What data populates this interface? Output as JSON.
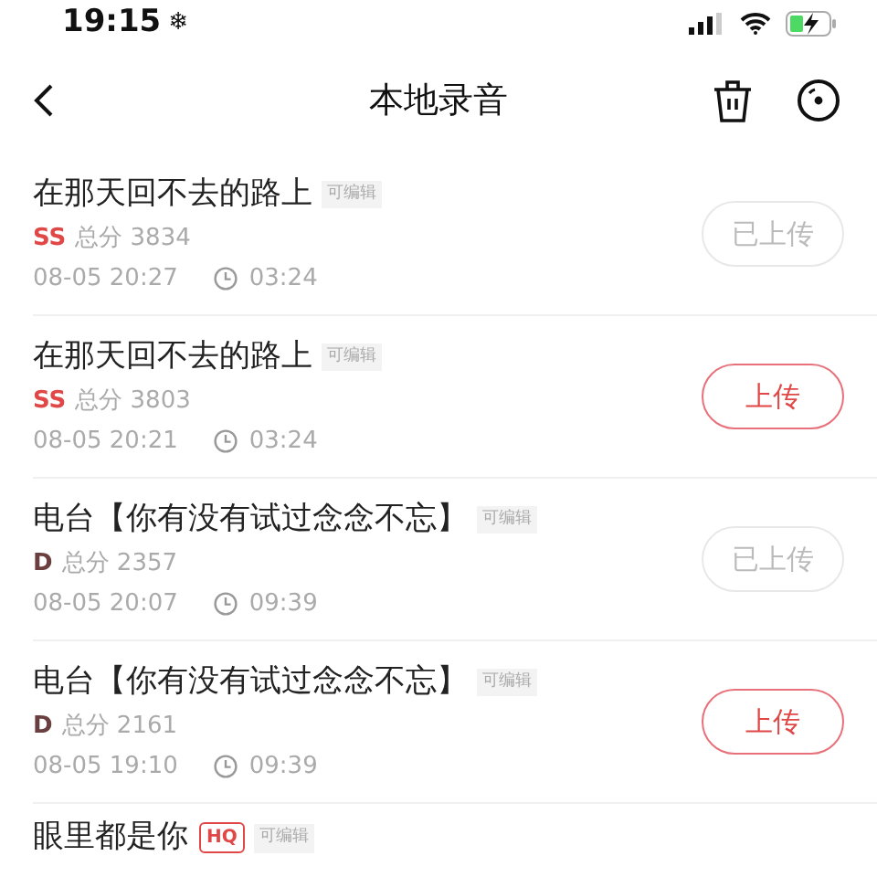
{
  "status_bar": {
    "time": "19:15",
    "snow": "❄"
  },
  "nav": {
    "title": "本地录音"
  },
  "recordings": [
    {
      "title": "在那天回不去的路上",
      "editable_tag": "可编辑",
      "grade": "SS",
      "color": "#e04848",
      "score": "总分 3834",
      "date": "08-05 20:27",
      "duration": "03:24",
      "uploaded": true,
      "button": "已上传"
    },
    {
      "title": "在那天回不去的路上",
      "editable_tag": "可编辑",
      "grade": "SS",
      "color": "#e04848",
      "score": "总分 3803",
      "date": "08-05 20:21",
      "duration": "03:24",
      "uploaded": false,
      "button": "上传"
    },
    {
      "title": "电台【你有没有试过念念不忘】",
      "editable_tag": "可编辑",
      "grade": "D",
      "color": "#6b3f3f",
      "score": "总分 2357",
      "date": "08-05 20:07",
      "duration": "09:39",
      "uploaded": true,
      "button": "已上传"
    },
    {
      "title": "电台【你有没有试过念念不忘】",
      "editable_tag": "可编辑",
      "grade": "D",
      "color": "#6b3f3f",
      "score": "总分 2161",
      "date": "08-05 19:10",
      "duration": "09:39",
      "uploaded": false,
      "button": "上传"
    },
    {
      "title": "眼里都是你",
      "quality_tag": "HQ",
      "editable_tag": "可编辑"
    }
  ]
}
